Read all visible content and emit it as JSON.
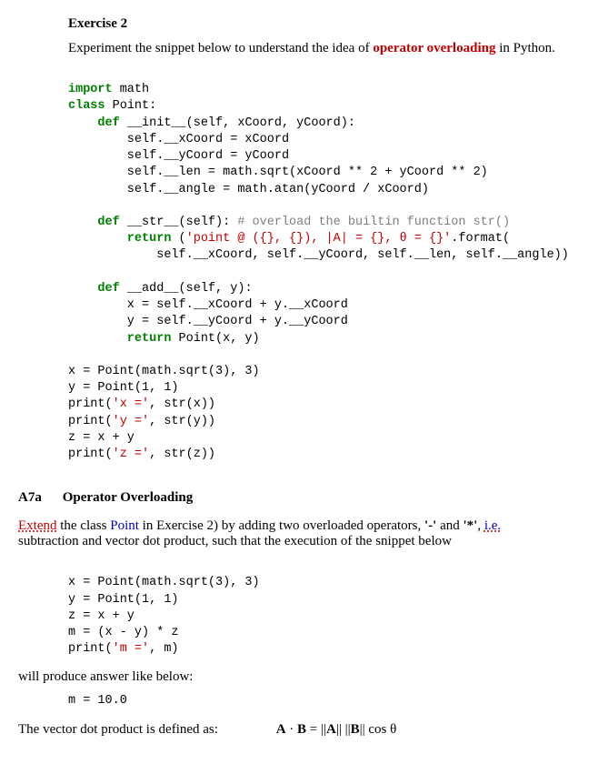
{
  "exercise": {
    "title": "Exercise 2",
    "intro_pre": "Experiment the snippet below to understand the idea of ",
    "intro_red": "operator overloading",
    "intro_post": " in Python."
  },
  "code1": {
    "l1a": "import",
    "l1b": " math",
    "l2a": "class",
    "l2b": " Point:",
    "l3a": "    def",
    "l3b": " __init__(self, xCoord, yCoord):",
    "l4": "        self.__xCoord = xCoord",
    "l5": "        self.__yCoord = yCoord",
    "l6": "        self.__len = math.sqrt(xCoord ** 2 + yCoord ** 2)",
    "l7": "        self.__angle = math.atan(yCoord / xCoord)",
    "l8a": "    def",
    "l8b": " __str__(self): ",
    "l8c": "# overload the builtin function str()",
    "l9a": "        return",
    "l9b": " (",
    "l9c": "'point @ ({}, {}), |A| = {}, θ = {}'",
    "l9d": ".format(",
    "l10": "            self.__xCoord, self.__yCoord, self.__len, self.__angle))",
    "l11a": "    def",
    "l11b": " __add__(self, y):",
    "l12": "        x = self.__xCoord + y.__xCoord",
    "l13": "        y = self.__yCoord + y.__yCoord",
    "l14a": "        return",
    "l14b": " Point(x, y)",
    "l15": "x = Point(math.sqrt(3), 3)",
    "l16": "y = Point(1, 1)",
    "l17a": "print(",
    "l17b": "'x ='",
    "l17c": ", str(x))",
    "l18a": "print(",
    "l18b": "'y ='",
    "l18c": ", str(y))",
    "l19": "z = x + y",
    "l20a": "print(",
    "l20b": "'z ='",
    "l20c": ", str(z))"
  },
  "section": {
    "label": "A7a",
    "title": "Operator Overloading"
  },
  "para1": {
    "pre": "Extend",
    "mid_a": " the class ",
    "point": "Point",
    "mid_b": " in Exercise 2) by adding two overloaded operators, ",
    "minus": "'-'",
    "and": " and ",
    "star": "'*'",
    "comma": ", ",
    "ie": "i.e.",
    "tail": "subtraction and vector dot product, such that the execution of the snippet below"
  },
  "code2": {
    "l1": "x = Point(math.sqrt(3), 3)",
    "l2": "y = Point(1, 1)",
    "l3": "z = x + y",
    "l4": "m = (x - y) * z",
    "l5a": "print(",
    "l5b": "'m ='",
    "l5c": ", m)"
  },
  "line_after_code2": "will produce answer like below:",
  "output": "m = 10.0",
  "finaldef_pre": "The vector dot product is defined as:",
  "formula": "A · B = ||A|| ||B|| cos θ"
}
